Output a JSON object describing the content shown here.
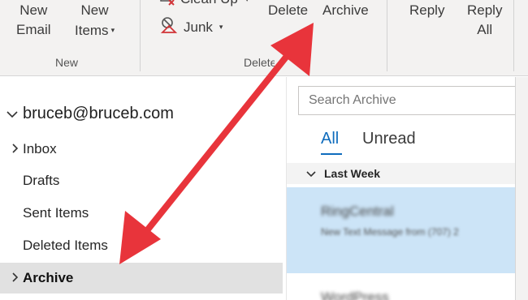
{
  "ribbon": {
    "new_email_line1": "New",
    "new_email_line2": "Email",
    "new_items_line1": "New",
    "new_items_line2": "Items",
    "new_group_label": "New",
    "clean_up_label": "Clean Up",
    "junk_label": "Junk",
    "delete_label": "Delete",
    "archive_label": "Archive",
    "delete_group_label": "Delete",
    "reply_label": "Reply",
    "reply_all_line1": "Reply",
    "reply_all_line2": "All"
  },
  "folders": {
    "account": "bruceb@bruceb.com",
    "items": [
      {
        "label": "Inbox",
        "chevron": true,
        "selected": false
      },
      {
        "label": "Drafts",
        "chevron": false,
        "selected": false
      },
      {
        "label": "Sent Items",
        "chevron": false,
        "selected": false
      },
      {
        "label": "Deleted Items",
        "chevron": false,
        "selected": false
      },
      {
        "label": "Archive",
        "chevron": true,
        "selected": true
      }
    ]
  },
  "list": {
    "search_placeholder": "Search Archive",
    "tab_all": "All",
    "tab_unread": "Unread",
    "group_header": "Last Week",
    "messages": [
      {
        "from": "RingCentral",
        "preview": "New Text Message from (707) 2"
      },
      {
        "from": "WordPress",
        "preview": ""
      }
    ]
  },
  "colors": {
    "accent": "#0f6cbd",
    "arrow": "#e8343b",
    "selected_message": "#cce4f7",
    "selected_folder": "#e1e1e1"
  }
}
